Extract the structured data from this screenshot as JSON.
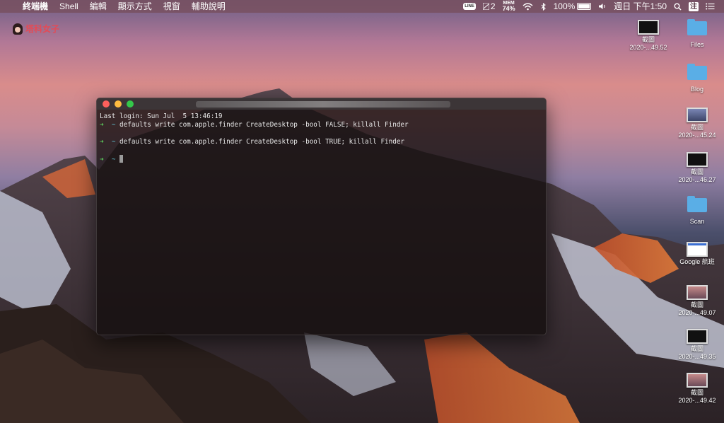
{
  "menubar": {
    "apple_symbol": "",
    "app_name": "終端機",
    "menus": [
      "Shell",
      "編輯",
      "顯示方式",
      "視窗",
      "輔助說明"
    ],
    "status": {
      "line_badge": "LINE",
      "count": "2",
      "mem_label": "MEM",
      "mem_value": "74%",
      "battery": "100%",
      "datetime": "週日 下午1:50",
      "ime": "注"
    }
  },
  "logo": {
    "text": "塔科女子"
  },
  "desktop_icons": [
    {
      "label1": "截圖",
      "label2": "2020-...49.52",
      "kind": "shot"
    },
    {
      "label1": "Files",
      "label2": "",
      "kind": "folder"
    },
    {
      "label1": "Blog",
      "label2": "",
      "kind": "folder"
    },
    {
      "label1": "截圖",
      "label2": "2020-...45.24",
      "kind": "shot"
    },
    {
      "label1": "截圖",
      "label2": "2020-...46.27",
      "kind": "shot"
    },
    {
      "label1": "Scan",
      "label2": "",
      "kind": "folder"
    },
    {
      "label1": "Google 航班",
      "label2": "",
      "kind": "page"
    },
    {
      "label1": "截圖",
      "label2": "2020-...49.07",
      "kind": "shot"
    },
    {
      "label1": "截圖",
      "label2": "2020-...49.35",
      "kind": "shot"
    },
    {
      "label1": "截圖",
      "label2": "2020-...49.42",
      "kind": "shot"
    }
  ],
  "terminal": {
    "last_login": "Last login: Sun Jul  5 13:46:19",
    "prompt_arrow": "➜",
    "prompt_dir": "~",
    "command1": "defaults write com.apple.finder CreateDesktop -bool FALSE; killall Finder",
    "command2": "defaults write com.apple.finder CreateDesktop -bool TRUE; killall Finder"
  }
}
